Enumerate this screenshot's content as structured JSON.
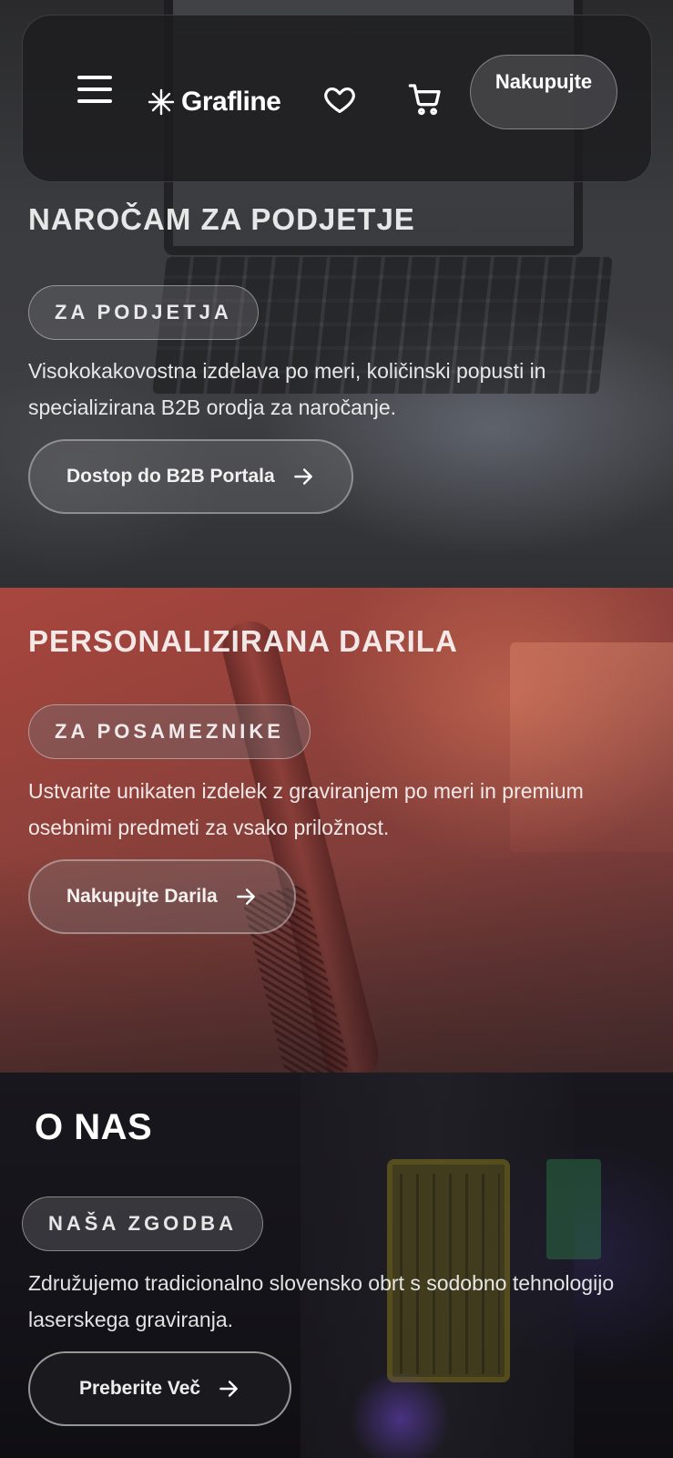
{
  "header": {
    "brand": "Grafline",
    "shop_button": "Nakupujte",
    "icons": [
      "menu-icon",
      "grafline-logo-icon",
      "heart-icon",
      "cart-icon"
    ]
  },
  "sections": {
    "b2b": {
      "title": "NAROČAM ZA PODJETJE",
      "tag": "ZA PODJETJA",
      "description": "Visokokakovostna izdelava po meri, količinski popusti in specializirana B2B orodja za naročanje.",
      "cta": "Dostop do B2B Portala"
    },
    "gifts": {
      "title": "PERSONALIZIRANA DARILA",
      "tag": "ZA POSAMEZNIKE",
      "description": "Ustvarite unikaten izdelek z graviranjem po meri in premium osebnimi predmeti za vsako priložnost.",
      "cta": "Nakupujte Darila"
    },
    "about": {
      "title": "O NAS",
      "tag": "NAŠA ZGODBA",
      "description": "Združujemo tradicionalno slovensko obrt s sodobno tehnologijo laserskega graviranja.",
      "cta": "Preberite Več"
    }
  },
  "colors": {
    "b2b_bg": "#3a3b3e",
    "gifts_bg": "#93423b",
    "about_bg": "#141319",
    "text": "#ffffff"
  }
}
